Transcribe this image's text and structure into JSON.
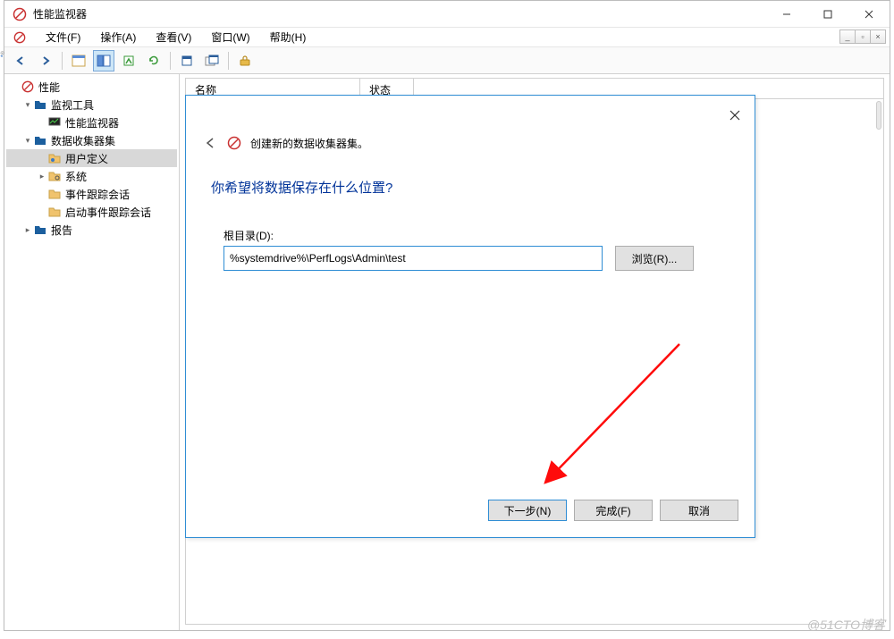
{
  "window": {
    "title": "性能监视器"
  },
  "menus": {
    "file": "文件(F)",
    "action": "操作(A)",
    "view": "查看(V)",
    "window": "窗口(W)",
    "help": "帮助(H)"
  },
  "tree": {
    "root": "性能",
    "mon_tools": "监视工具",
    "perf_mon": "性能监视器",
    "dcs": "数据收集器集",
    "user_def": "用户定义",
    "system": "系统",
    "ets": "事件跟踪会话",
    "startup_ets": "启动事件跟踪会话",
    "reports": "报告"
  },
  "list": {
    "col_name": "名称",
    "col_status": "状态"
  },
  "dialog": {
    "title": "创建新的数据收集器集。",
    "heading": "你希望将数据保存在什么位置?",
    "root_dir_label": "根目录(D):",
    "root_dir_value": "%systemdrive%\\PerfLogs\\Admin\\test",
    "browse": "浏览(R)...",
    "next": "下一步(N)",
    "finish": "完成(F)",
    "cancel": "取消"
  },
  "watermark": "@51CTO博客"
}
